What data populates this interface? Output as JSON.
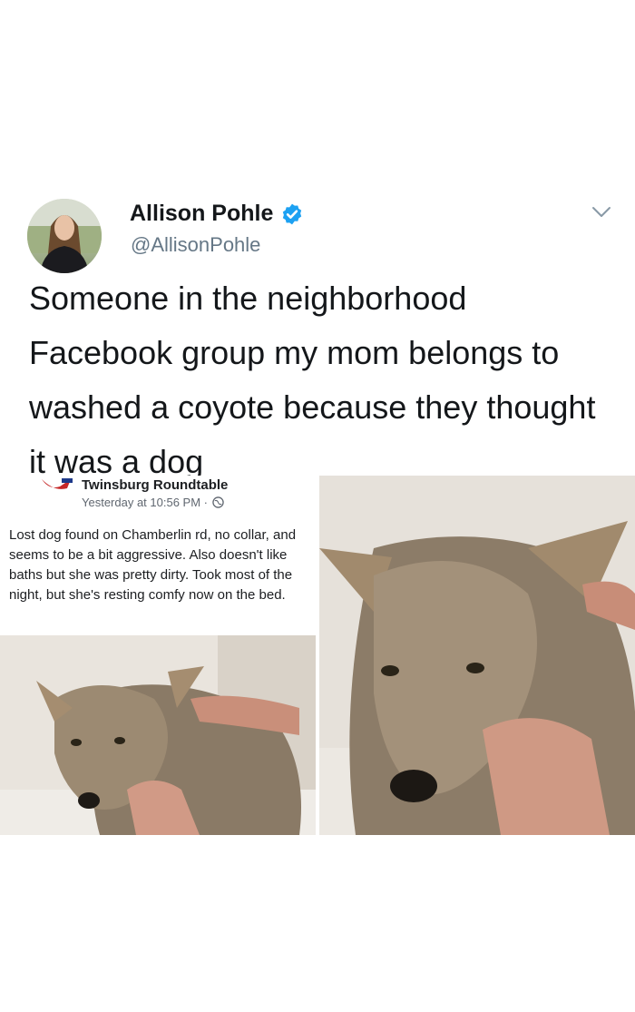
{
  "tweet": {
    "display_name": "Allison Pohle",
    "handle": "@AllisonPohle",
    "text": "Someone in the neighborhood Facebook group my mom belongs to washed a coyote because they thought it was a dog",
    "verified": true,
    "icons": {
      "verified": "verified-badge-icon",
      "menu": "chevron-down-icon"
    },
    "colors": {
      "verified": "#1da1f2",
      "handle": "#657786"
    }
  },
  "facebook_post": {
    "group_name": "Twinsburg Roundtable",
    "timestamp": "Yesterday at 10:56 PM ·",
    "text": "Lost dog found on Chamberlin rd, no collar, and seems to be a bit aggressive. Also doesn't like baths but she was pretty dirty. Took most of the night, but she's resting comfy now on the bed.",
    "icons": {
      "privacy": "globe-icon"
    }
  }
}
